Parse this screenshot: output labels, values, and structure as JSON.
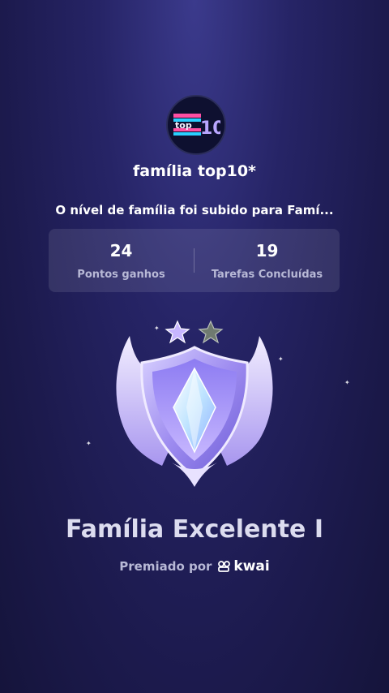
{
  "family": {
    "name": "família top10*",
    "logo_text": "TOP 10"
  },
  "level_message": "O nível de família foi subido para Famí...",
  "stats": [
    {
      "value": "24",
      "label": "Pontos ganhos"
    },
    {
      "value": "19",
      "label": "Tarefas Concluídas"
    }
  ],
  "badge": {
    "title": "Família Excelente I",
    "stars_filled": 1,
    "stars_total": 2,
    "icon": "shield-crystal-badge"
  },
  "awarded": {
    "label": "Premiado por",
    "brand": "kwai"
  },
  "colors": {
    "background_top": "#3b3a8c",
    "background_bottom": "#15143b",
    "accent_purple": "#8a7cf0"
  }
}
